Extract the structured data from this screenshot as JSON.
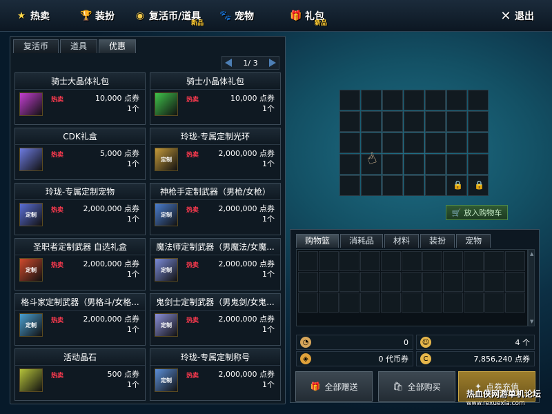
{
  "nav": {
    "hot": "热卖",
    "costume": "装扮",
    "revive": "复活币/道具",
    "revive_new": "新品",
    "pet": "宠物",
    "gift": "礼包",
    "gift_new": "新品",
    "exit": "退出"
  },
  "left_tabs": [
    "复活币",
    "道具",
    "优惠"
  ],
  "pager": {
    "text": "1/ 3"
  },
  "hot_label": "热卖",
  "unit_label": "点券",
  "items": [
    {
      "title": "骑士大晶体礼包",
      "price": "10,000",
      "qty": "1个",
      "icon": "purple-box-icon",
      "color": "#c23fcf"
    },
    {
      "title": "骑士小晶体礼包",
      "price": "10,000",
      "qty": "1个",
      "icon": "green-box-icon",
      "color": "#3fc24a"
    },
    {
      "title": "CDK礼盒",
      "price": "5,000",
      "qty": "1个",
      "icon": "lucky-box-icon",
      "color": "#6d7be0"
    },
    {
      "title": "玲珑-专属定制光环",
      "price": "2,000,000",
      "qty": "1个",
      "icon": "custom-halo-icon",
      "color": "#c49a3a"
    },
    {
      "title": "玲珑-专属定制宠物",
      "price": "2,000,000",
      "qty": "1个",
      "icon": "custom-pet-icon",
      "color": "#5b6fd8"
    },
    {
      "title": "神枪手定制武器（男枪/女枪）",
      "price": "2,000,000",
      "qty": "1个",
      "icon": "custom-gun-icon",
      "color": "#4a7ed0"
    },
    {
      "title": "圣职者定制武器 自选礼盒",
      "price": "2,000,000",
      "qty": "1个",
      "icon": "custom-priest-icon",
      "color": "#d04a2c"
    },
    {
      "title": "魔法师定制武器（男魔法/女魔...",
      "price": "2,000,000",
      "qty": "1个",
      "icon": "custom-mage-icon",
      "color": "#7a8bd8"
    },
    {
      "title": "格斗家定制武器（男格斗/女格...",
      "price": "2,000,000",
      "qty": "1个",
      "icon": "custom-fighter-icon",
      "color": "#4a9fd0"
    },
    {
      "title": "鬼剑士定制武器（男鬼剑/女鬼...",
      "price": "2,000,000",
      "qty": "1个",
      "icon": "custom-sword-icon",
      "color": "#8a8fd8"
    },
    {
      "title": "活动晶石",
      "price": "500",
      "qty": "1个",
      "icon": "event-crystal-icon",
      "color": "#b5c23a"
    },
    {
      "title": "玲珑-专属定制称号",
      "price": "2,000,000",
      "qty": "1个",
      "icon": "custom-title-icon",
      "color": "#5b8fd8"
    }
  ],
  "custom_tag": "定制",
  "add_to_cart": "放入购物车",
  "basket_tabs": [
    "购物篮",
    "消耗品",
    "材料",
    "装扮",
    "宠物"
  ],
  "info": {
    "row1_left": "0",
    "row1_right": "4 个",
    "row2_left": "0 代币券",
    "row2_right": "7,856,240 点券"
  },
  "buttons": {
    "gift_all": "全部赠送",
    "buy_all": "全部购买",
    "recharge": "点券充值"
  },
  "watermark": "热血侠网游单机论坛",
  "watermark_url": "www.rexuexia.com"
}
